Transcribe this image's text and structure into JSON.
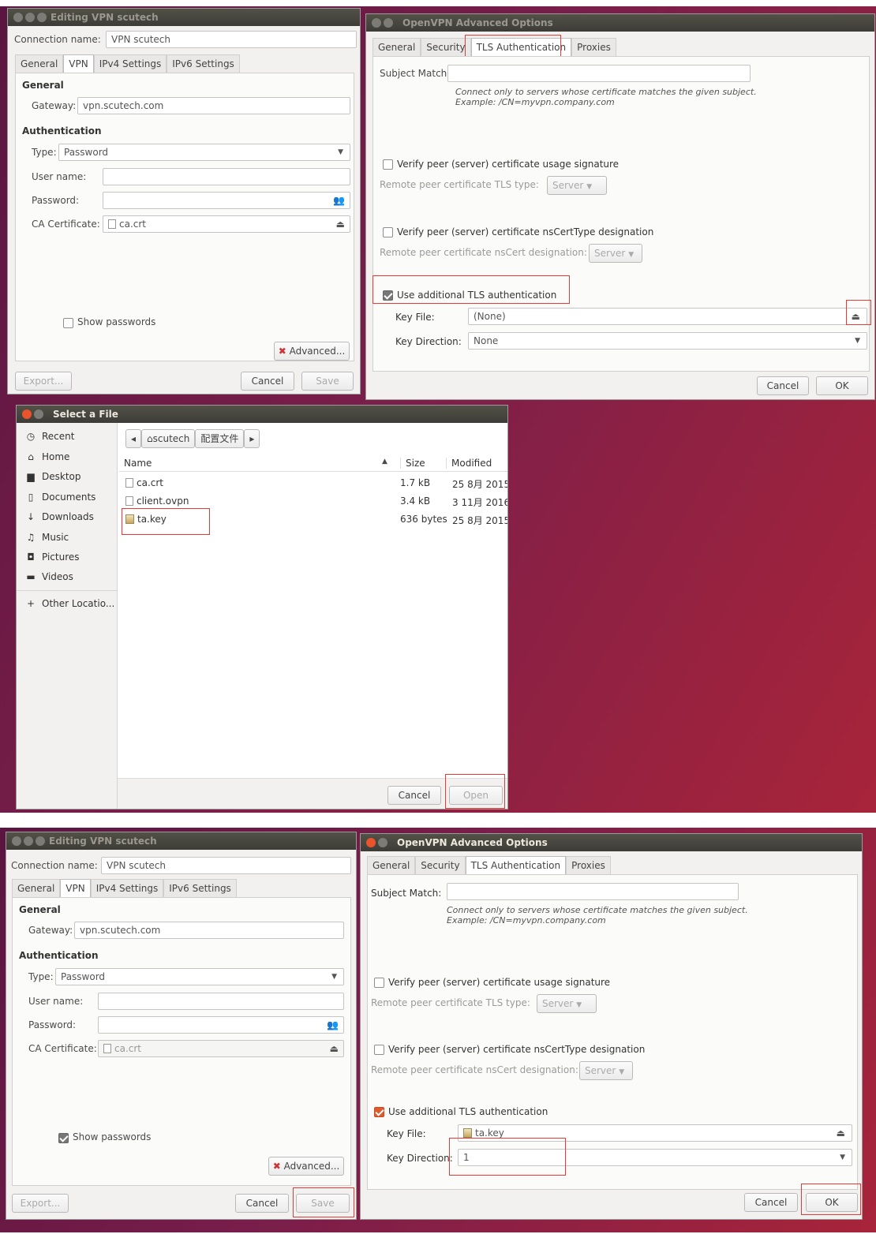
{
  "vpn_editor": {
    "title": "Editing VPN scutech",
    "connection_label": "Connection name:",
    "connection_value": "VPN scutech",
    "tabs": [
      "General",
      "VPN",
      "IPv4 Settings",
      "IPv6 Settings"
    ],
    "section_general": "General",
    "gateway_label": "Gateway:",
    "gateway_value": "vpn.scutech.com",
    "section_auth": "Authentication",
    "type_label": "Type:",
    "type_value": "Password",
    "username_label": "User name:",
    "password_label": "Password:",
    "ca_label": "CA Certificate:",
    "ca_value": "ca.crt",
    "show_passwords": "Show passwords",
    "advanced": "Advanced...",
    "export": "Export...",
    "cancel": "Cancel",
    "save": "Save"
  },
  "openvpn": {
    "title": "OpenVPN Advanced Options",
    "tabs": [
      "General",
      "Security",
      "TLS Authentication",
      "Proxies"
    ],
    "subject_label": "Subject Match:",
    "hint1": "Connect only to servers whose certificate matches the given subject.",
    "hint2": "Example: /CN=myvpn.company.com",
    "verify_usage": "Verify peer (server) certificate usage signature",
    "tls_type_label": "Remote peer certificate TLS type:",
    "tls_type_value": "Server",
    "verify_ns": "Verify peer (server) certificate nsCertType designation",
    "ns_label": "Remote peer certificate nsCert designation:",
    "ns_value": "Server",
    "use_tls": "Use additional TLS authentication",
    "keyfile_label": "Key File:",
    "key_direction_label": "Key Direction:",
    "cancel": "Cancel",
    "ok": "OK",
    "state1": {
      "keyfile": "(None)",
      "direction": "None"
    },
    "state2": {
      "keyfile": "ta.key",
      "direction": "1"
    }
  },
  "file_chooser": {
    "title": "Select a File",
    "sidebar": [
      "Recent",
      "Home",
      "Desktop",
      "Documents",
      "Downloads",
      "Music",
      "Pictures",
      "Videos",
      "Other Locatio..."
    ],
    "path": [
      "scutech",
      "配置文件"
    ],
    "columns": {
      "name": "Name",
      "size": "Size",
      "modified": "Modified"
    },
    "files": [
      {
        "name": "ca.crt",
        "size": "1.7 kB",
        "modified": "25 8月 2015"
      },
      {
        "name": "client.ovpn",
        "size": "3.4 kB",
        "modified": "3 11月 2016"
      },
      {
        "name": "ta.key",
        "size": "636 bytes",
        "modified": "25 8月 2015"
      }
    ],
    "cancel": "Cancel",
    "open": "Open"
  },
  "colors": {
    "accent": "#e9542c",
    "highlight": "#e53a35",
    "titlebar": "#3d3c37"
  }
}
